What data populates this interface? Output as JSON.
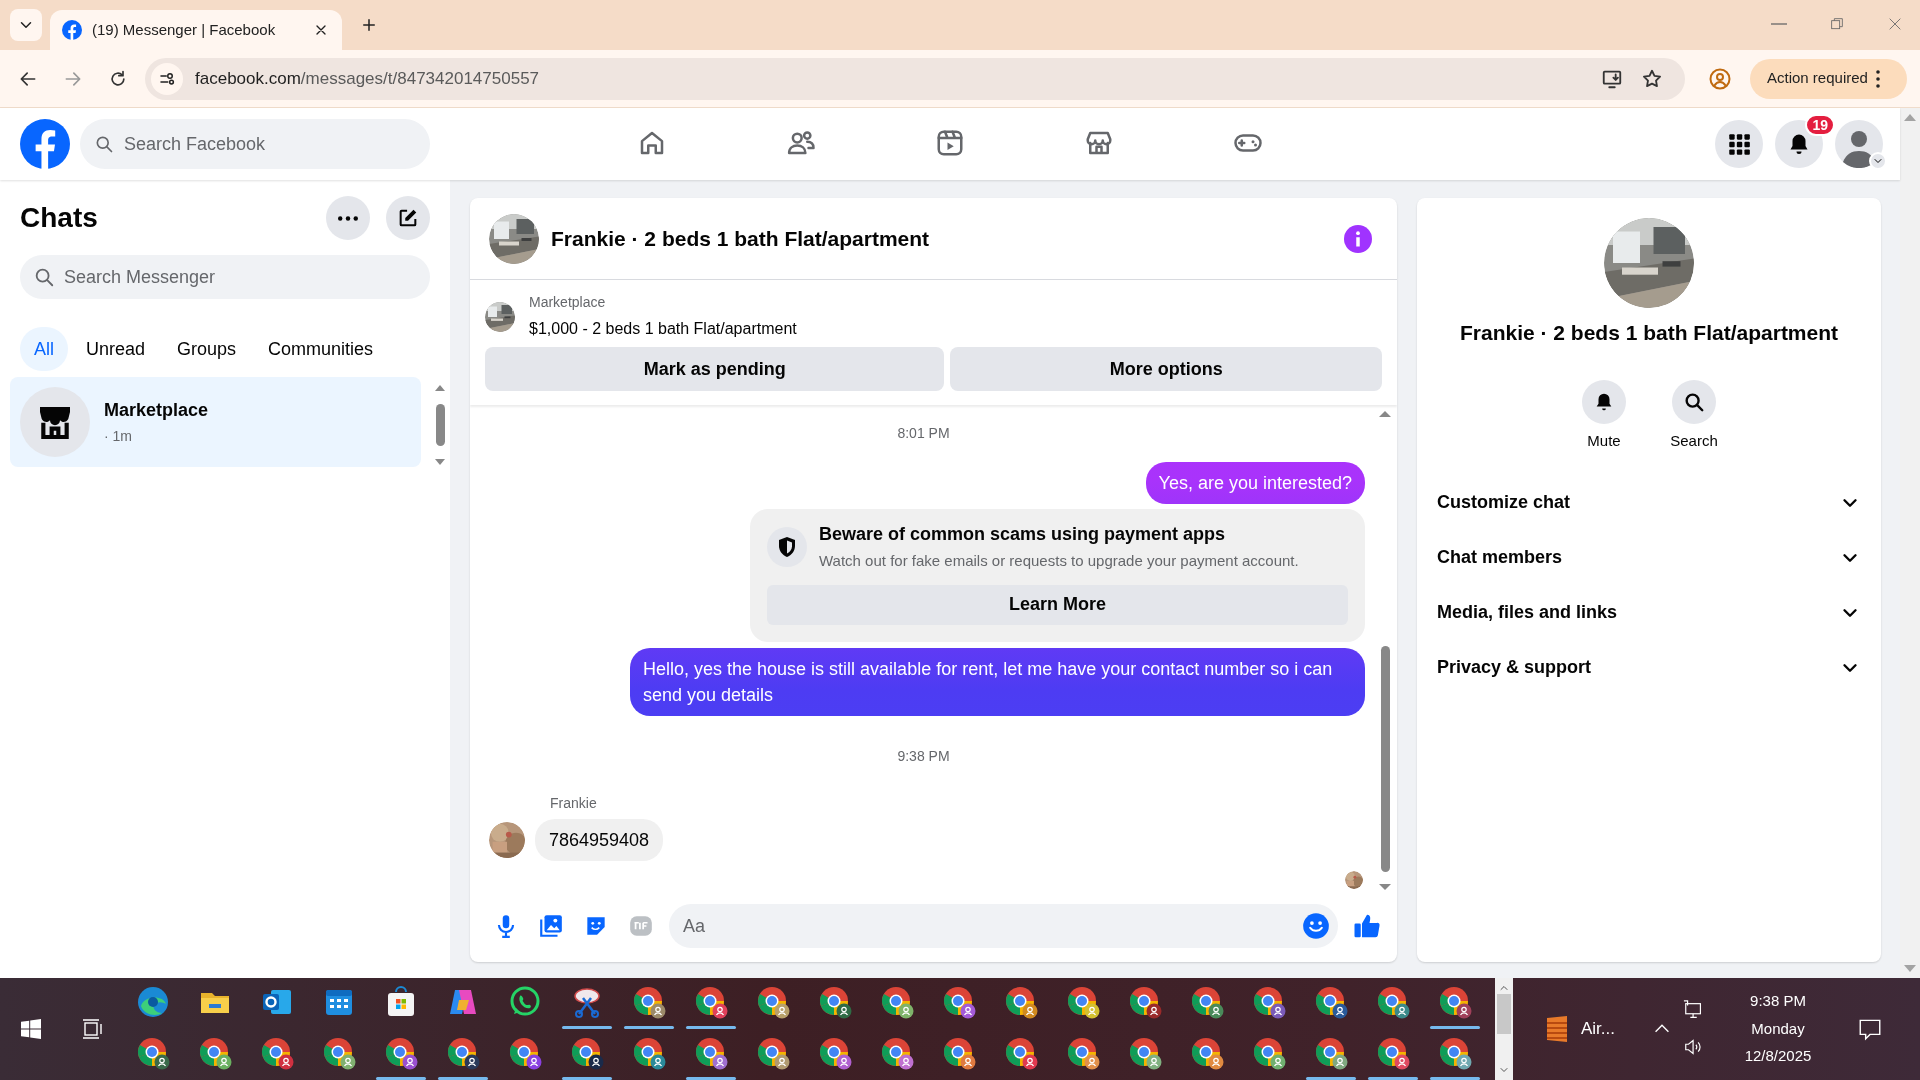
{
  "browser": {
    "tab_title": "(19) Messenger | Facebook",
    "url_host": "facebook.com",
    "url_path": "/messages/t/847342014750557",
    "action_button": "Action required"
  },
  "header": {
    "search": {
      "placeholder": "Search Facebook"
    },
    "nav": [
      {
        "kind": "home",
        "selected": false
      },
      {
        "kind": "friends",
        "selected": false
      },
      {
        "kind": "video",
        "selected": false
      },
      {
        "kind": "marketplace",
        "selected": false
      },
      {
        "kind": "gaming",
        "selected": false
      }
    ],
    "notification_count": "19"
  },
  "chats": {
    "title": "Chats",
    "search": {
      "placeholder": "Search Messenger"
    },
    "filters": [
      {
        "label": "All",
        "selected": true
      },
      {
        "label": "Unread",
        "selected": false
      },
      {
        "label": "Groups",
        "selected": false
      },
      {
        "label": "Communities",
        "selected": false
      }
    ],
    "items": [
      {
        "name": "Marketplace",
        "time": "· 1m",
        "selected": true
      }
    ]
  },
  "conversation": {
    "title": "Frankie · 2 beds 1 bath Flat/apartment",
    "listing": {
      "source": "Marketplace",
      "title": "$1,000 - 2 beds 1 bath Flat/apartment"
    },
    "actions": [
      "Mark as pending",
      "More options"
    ],
    "messages": [
      {
        "kind": "time",
        "text": "8:01 PM"
      },
      {
        "kind": "outgoing",
        "text": "Yes, are you interested?"
      },
      {
        "kind": "notice",
        "title": "Beware of common scams using payment apps",
        "text": "Watch out for fake emails or requests to upgrade your payment account.",
        "button": "Learn More"
      },
      {
        "kind": "outgoing",
        "text": "Hello, yes the house is still available for rent, let me have your contact number so i can send you details"
      },
      {
        "kind": "time",
        "text": "9:38 PM"
      },
      {
        "kind": "incoming",
        "sender": "Frankie",
        "text": "7864959408"
      }
    ],
    "composer": {
      "placeholder": "Aa"
    }
  },
  "details": {
    "title": "Frankie · 2 beds 1 bath Flat/apartment",
    "actions": [
      {
        "kind": "mute",
        "label": "Mute"
      },
      {
        "kind": "search",
        "label": "Search"
      }
    ],
    "sections": [
      "Customize chat",
      "Chat members",
      "Media, files and links",
      "Privacy & support"
    ]
  },
  "taskbar": {
    "rows": [
      [
        {
          "kind": "edge",
          "running": false
        },
        {
          "kind": "folder",
          "running": false
        },
        {
          "kind": "mail",
          "running": false
        },
        {
          "kind": "calendar",
          "running": false
        },
        {
          "kind": "store",
          "running": false
        },
        {
          "kind": "copilot",
          "running": false
        },
        {
          "kind": "whatsapp",
          "running": false
        },
        {
          "kind": "snip",
          "running": true
        },
        {
          "kind": "chrome",
          "color": "#9c8a6a",
          "running": true
        },
        {
          "kind": "chrome",
          "color": "#e0405a",
          "running": true
        },
        {
          "kind": "chrome",
          "color": "#b8a06a",
          "running": false
        },
        {
          "kind": "chrome",
          "color": "#2f6b45",
          "running": false
        },
        {
          "kind": "chrome",
          "color": "#7fb36a",
          "running": false
        },
        {
          "kind": "chrome",
          "color": "#a35ad8",
          "running": false
        },
        {
          "kind": "chrome",
          "color": "#d08a20",
          "running": false
        },
        {
          "kind": "chrome",
          "color": "#d4c030",
          "running": false
        },
        {
          "kind": "chrome",
          "color": "#9a2a2a",
          "running": false
        },
        {
          "kind": "chrome",
          "color": "#4a8a5a",
          "running": false
        },
        {
          "kind": "chrome",
          "color": "#7a5ab8",
          "running": false
        },
        {
          "kind": "chrome",
          "color": "#2a5a9a",
          "running": false
        },
        {
          "kind": "chrome",
          "color": "#3a8a8a",
          "running": false
        },
        {
          "kind": "chrome",
          "color": "#a0405a",
          "running": true
        }
      ],
      [
        {
          "kind": "chrome",
          "color": "#3a6a4a",
          "running": false
        },
        {
          "kind": "chrome",
          "color": "#6ab060",
          "running": false
        },
        {
          "kind": "chrome",
          "color": "#d03040",
          "running": false
        },
        {
          "kind": "chrome",
          "color": "#80b070",
          "running": false
        },
        {
          "kind": "chrome",
          "color": "#9a50d0",
          "running": true
        },
        {
          "kind": "chrome",
          "color": "#2a3a5a",
          "running": true
        },
        {
          "kind": "chrome",
          "color": "#8a40e0",
          "running": false
        },
        {
          "kind": "chrome",
          "color": "#1a2a4a",
          "running": true
        },
        {
          "kind": "chrome",
          "color": "#2a8a9a",
          "running": false
        },
        {
          "kind": "chrome",
          "color": "#a070d0",
          "running": true
        },
        {
          "kind": "chrome",
          "color": "#b09a70",
          "running": false
        },
        {
          "kind": "chrome",
          "color": "#b060d0",
          "running": false
        },
        {
          "kind": "chrome",
          "color": "#c070d0",
          "running": false
        },
        {
          "kind": "chrome",
          "color": "#e07a40",
          "running": false
        },
        {
          "kind": "chrome",
          "color": "#e03a50",
          "running": false
        },
        {
          "kind": "chrome",
          "color": "#e0904a",
          "running": false
        },
        {
          "kind": "chrome",
          "color": "#80b080",
          "running": false
        },
        {
          "kind": "chrome",
          "color": "#e08a40",
          "running": false
        },
        {
          "kind": "chrome",
          "color": "#70b070",
          "running": false
        },
        {
          "kind": "chrome",
          "color": "#80a880",
          "running": true
        },
        {
          "kind": "chrome",
          "color": "#e04a60",
          "running": true
        },
        {
          "kind": "chrome",
          "color": "#70a8b0",
          "running": true
        }
      ]
    ],
    "tray": {
      "app": "Air...",
      "time": "9:38 PM",
      "day": "Monday",
      "date": "12/8/2025"
    }
  }
}
